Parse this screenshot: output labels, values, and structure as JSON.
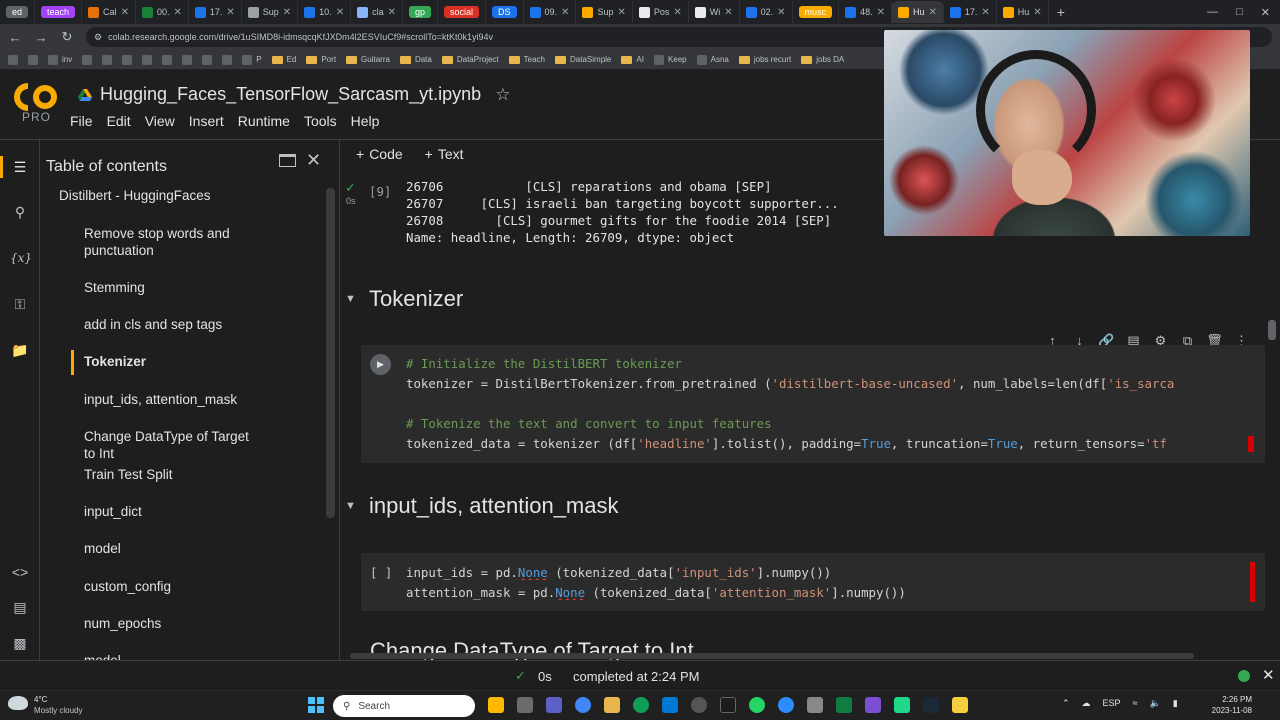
{
  "browser": {
    "tabs": [
      {
        "label": "ed",
        "kind": "pill",
        "color": "#5f6368"
      },
      {
        "label": "teach",
        "kind": "pill",
        "color": "#a142f4"
      },
      {
        "label": "Cal",
        "kind": "tab",
        "color": "#e8710a"
      },
      {
        "label": "00.",
        "kind": "tab",
        "color": "#188038"
      },
      {
        "label": "17.",
        "kind": "tab",
        "color": "#1a73e8"
      },
      {
        "label": "Sup",
        "kind": "tab",
        "color": "#9aa0a6"
      },
      {
        "label": "10.",
        "kind": "tab",
        "color": "#1a73e8"
      },
      {
        "label": "cla",
        "kind": "tab",
        "color": "#8ab4f8"
      },
      {
        "label": "gp",
        "kind": "pill",
        "color": "#34a853"
      },
      {
        "label": "social",
        "kind": "pill",
        "color": "#d93025"
      },
      {
        "label": "DS",
        "kind": "pill",
        "color": "#1a73e8"
      },
      {
        "label": "09.",
        "kind": "tab",
        "color": "#1a73e8"
      },
      {
        "label": "Sup",
        "kind": "tab",
        "color": "#f9ab00"
      },
      {
        "label": "Pos",
        "kind": "tab",
        "color": "#e8eaed"
      },
      {
        "label": "Wi",
        "kind": "tab",
        "color": "#e8eaed"
      },
      {
        "label": "02.",
        "kind": "tab",
        "color": "#1a73e8"
      },
      {
        "label": "musc",
        "kind": "pill",
        "color": "#f9ab00"
      },
      {
        "label": "48.",
        "kind": "tab",
        "color": "#1a73e8"
      },
      {
        "label": "Hu",
        "kind": "active",
        "color": "#f9ab00"
      },
      {
        "label": "17.",
        "kind": "tab",
        "color": "#1a73e8"
      },
      {
        "label": "Hu",
        "kind": "tab",
        "color": "#f9ab00"
      }
    ],
    "new_tab": "+",
    "url": "colab.research.google.com/drive/1uSIMD8i-idmsqcqKfJXDm4l2ESVIuCf9#scrollTo=ktKt0k1yi94v",
    "bookmarks": [
      {
        "label": "",
        "kind": "icon"
      },
      {
        "label": "",
        "kind": "icon"
      },
      {
        "label": "inv",
        "kind": "icon"
      },
      {
        "label": "",
        "kind": "icon"
      },
      {
        "label": "",
        "kind": "icon"
      },
      {
        "label": "",
        "kind": "icon"
      },
      {
        "label": "",
        "kind": "icon"
      },
      {
        "label": "",
        "kind": "icon"
      },
      {
        "label": "",
        "kind": "icon"
      },
      {
        "label": "",
        "kind": "icon"
      },
      {
        "label": "",
        "kind": "icon"
      },
      {
        "label": "P",
        "kind": "icon"
      },
      {
        "label": "Ed",
        "kind": "folder"
      },
      {
        "label": "Port",
        "kind": "folder"
      },
      {
        "label": "Guitarra",
        "kind": "folder"
      },
      {
        "label": "Data",
        "kind": "folder"
      },
      {
        "label": "DataProject",
        "kind": "folder"
      },
      {
        "label": "Teach",
        "kind": "folder"
      },
      {
        "label": "DataSimple",
        "kind": "folder"
      },
      {
        "label": "AI",
        "kind": "folder"
      },
      {
        "label": "Keep",
        "kind": "icon"
      },
      {
        "label": "Asna",
        "kind": "icon"
      },
      {
        "label": "jobs recurt",
        "kind": "folder"
      },
      {
        "label": "jobs DA",
        "kind": "folder"
      }
    ]
  },
  "colab": {
    "logo_text": "CO",
    "pro_label": "PRO",
    "notebook_title": "Hugging_Faces_TensorFlow_Sarcasm_yt.ipynb",
    "menu": [
      "File",
      "Edit",
      "View",
      "Insert",
      "Runtime",
      "Tools",
      "Help"
    ],
    "toolbar": {
      "code_label": "Code",
      "text_label": "Text",
      "plus": "+"
    }
  },
  "toc": {
    "title": "Table of contents",
    "items": [
      {
        "label": "Distilbert - HuggingFaces",
        "level": 1
      },
      {
        "label": "Remove stop words and punctuation",
        "level": 2
      },
      {
        "label": "Stemming",
        "level": 2
      },
      {
        "label": "add in cls and sep tags",
        "level": 2
      },
      {
        "label": "Tokenizer",
        "level": 2,
        "active": true
      },
      {
        "label": "input_ids, attention_mask",
        "level": 2
      },
      {
        "label": "Change DataType of Target to Int",
        "level": 2
      },
      {
        "label": "Train Test Split",
        "level": 2
      },
      {
        "label": "input_dict",
        "level": 2
      },
      {
        "label": "model",
        "level": 2
      },
      {
        "label": "custom_config",
        "level": 2
      },
      {
        "label": "num_epochs",
        "level": 2
      },
      {
        "label": "model",
        "level": 2
      }
    ]
  },
  "output_cell": {
    "exec_count": "[9]",
    "duration": "0s",
    "lines": [
      "26706           [CLS] reparations and obama [SEP]",
      "26707     [CLS] israeli ban targeting boycott supporter...",
      "26708       [CLS] gourmet gifts for the foodie 2014 [SEP]",
      "Name: headline, Length: 26709, dtype: object"
    ]
  },
  "sections": {
    "tokenizer": "Tokenizer",
    "input_ids": "input_ids, attention_mask",
    "next": "Change DataType of Target to Int"
  },
  "tokenizer_cell": {
    "comment1": "# Initialize the DistilBERT tokenizer",
    "line1_a": "tokenizer = DistilBertTokenizer.from_pretrained (",
    "line1_str": "'distilbert-base-uncased'",
    "line1_b": ", num_labels=len(df[",
    "line1_str2": "'is_sarca",
    "comment2": "# Tokenize the text and convert to input features",
    "line2_a": "tokenized_data = tokenizer (df[",
    "line2_str": "'headline'",
    "line2_b": "].tolist(), padding=",
    "line2_true1": "True",
    "line2_c": ", truncation=",
    "line2_true2": "True",
    "line2_d": ", return_tensors=",
    "line2_str2": "'tf"
  },
  "input_cell": {
    "exec_count": "[ ]",
    "line1_a": "input_ids = pd.",
    "line1_none": "None",
    "line1_b": " (tokenized_data[",
    "line1_str": "'input_ids'",
    "line1_c": "].numpy())",
    "line2_a": "attention_mask = pd.",
    "line2_none": "None",
    "line2_b": " (tokenized_data[",
    "line2_str": "'attention_mask'",
    "line2_c": "].numpy())"
  },
  "statusbar": {
    "duration": "0s",
    "message": "completed at 2:24 PM"
  },
  "taskbar": {
    "weather_temp": "4°C",
    "weather_desc": "Mostly cloudy",
    "search_placeholder": "Search",
    "lang": "ESP",
    "time": "2:26 PM",
    "date": "2023-11-08"
  },
  "colors": {
    "accent": "#f9ab00",
    "success": "#34a853",
    "error": "#d50000"
  }
}
